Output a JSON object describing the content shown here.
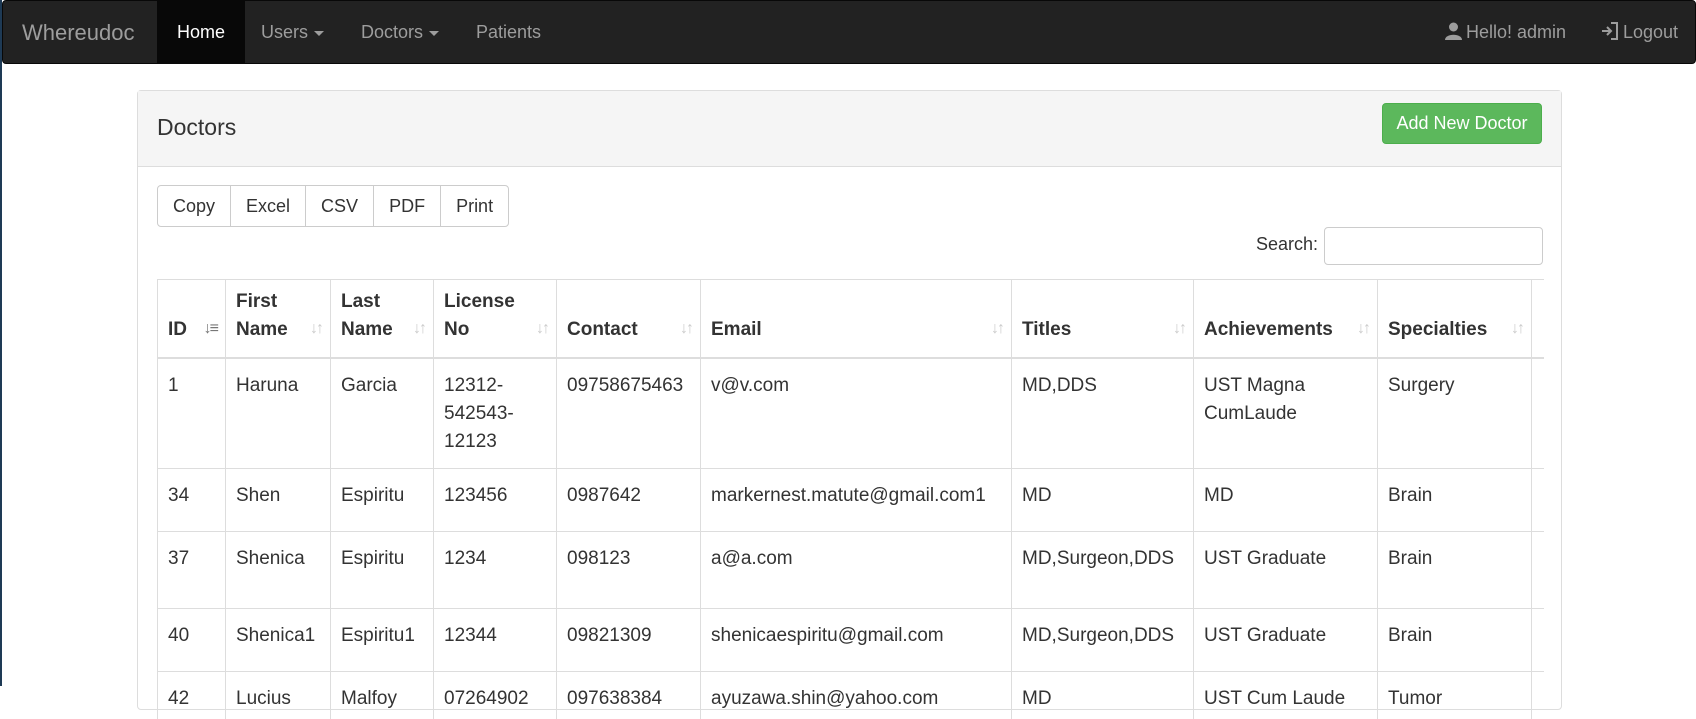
{
  "navbar": {
    "brand": "Whereudoc",
    "items": [
      "Home",
      "Users",
      "Doctors",
      "Patients"
    ],
    "greeting": "Hello! admin",
    "logout": "Logout"
  },
  "panel": {
    "title": "Doctors",
    "add_button": "Add New Doctor"
  },
  "export_buttons": [
    "Copy",
    "Excel",
    "CSV",
    "PDF",
    "Print"
  ],
  "search": {
    "label": "Search:",
    "value": ""
  },
  "table": {
    "headers": {
      "id": "ID",
      "first_name_1": "First",
      "first_name_2": "Name",
      "last_name_1": "Last",
      "last_name_2": "Name",
      "license_1": "License",
      "license_2": "No",
      "contact": "Contact",
      "email": "Email",
      "titles": "Titles",
      "achievements": "Achievements",
      "specialties": "Specialties"
    },
    "rows": [
      {
        "id": "1",
        "first": "Haruna",
        "last": "Garcia",
        "license": "12312-542543-12123",
        "contact": "09758675463",
        "email": "v@v.com",
        "titles": "MD,DDS",
        "achievements": "UST Magna CumLaude",
        "specialties": "Surgery"
      },
      {
        "id": "34",
        "first": "Shen",
        "last": "Espiritu",
        "license": "123456",
        "contact": "0987642",
        "email": "markernest.matute@gmail.com1",
        "titles": "MD",
        "achievements": "MD",
        "specialties": "Brain"
      },
      {
        "id": "37",
        "first": "Shenica",
        "last": "Espiritu",
        "license": "1234",
        "contact": "098123",
        "email": "a@a.com",
        "titles": "MD,Surgeon,DDS",
        "achievements": "UST Graduate",
        "specialties": "Brain"
      },
      {
        "id": "40",
        "first": "Shenica1",
        "last": "Espiritu1",
        "license": "12344",
        "contact": "09821309",
        "email": "shenicaespiritu@gmail.com",
        "titles": "MD,Surgeon,DDS",
        "achievements": "UST Graduate",
        "specialties": "Brain"
      },
      {
        "id": "42",
        "first": "Lucius",
        "last": "Malfoy",
        "license": "07264902",
        "contact": "097638384",
        "email": "ayuzawa.shin@yahoo.com",
        "titles": "MD",
        "achievements": "UST Cum Laude",
        "specialties": "Tumor"
      }
    ]
  },
  "colors": {
    "navbar": "#222222",
    "success": "#5cb85c"
  }
}
